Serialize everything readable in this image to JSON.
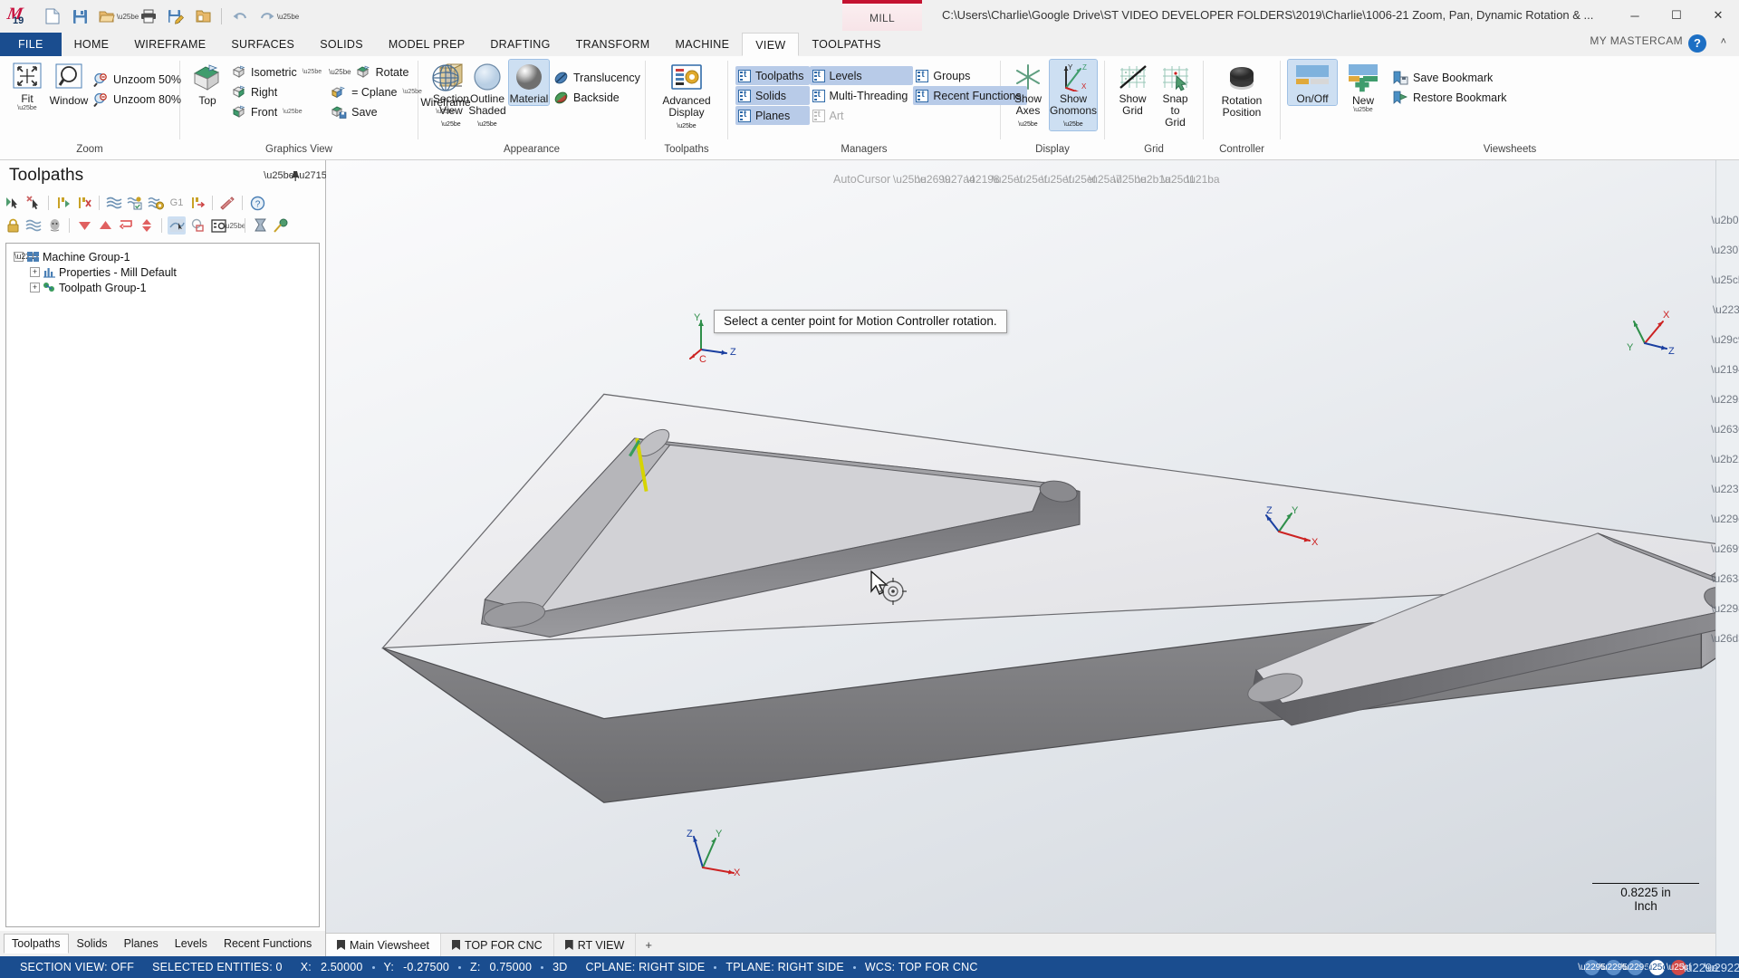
{
  "titlebar": {
    "logo_text": "19",
    "qat": [
      {
        "name": "new-file-icon",
        "glyph": "new"
      },
      {
        "name": "save-icon",
        "glyph": "save"
      },
      {
        "name": "open-folder-icon",
        "glyph": "open"
      },
      {
        "name": "print-icon",
        "glyph": "print"
      },
      {
        "name": "save-as-icon",
        "glyph": "saveas"
      },
      {
        "name": "backup-icon",
        "glyph": "backup"
      },
      {
        "name": "undo-icon",
        "glyph": "undo"
      },
      {
        "name": "redo-icon",
        "glyph": "redo"
      },
      {
        "name": "customize-qat-icon",
        "glyph": "dropdown"
      }
    ],
    "mill_tab": "MILL",
    "file_path": "C:\\Users\\Charlie\\Google Drive\\ST VIDEO DEVELOPER FOLDERS\\2019\\Charlie\\1006-21 Zoom, Pan, Dynamic Rotation & ...",
    "minimize": "─",
    "maximize": "☐",
    "close": "✕"
  },
  "ribbon_tabs": {
    "file": "FILE",
    "tabs": [
      "HOME",
      "WIREFRAME",
      "SURFACES",
      "SOLIDS",
      "MODEL PREP",
      "DRAFTING",
      "TRANSFORM",
      "MACHINE",
      "VIEW",
      "TOOLPATHS"
    ],
    "active": "VIEW",
    "my_mastercam": "MY MASTERCAM",
    "help": "?",
    "collapse": "˄"
  },
  "ribbon": {
    "groups": [
      {
        "name": "zoom",
        "label": "Zoom",
        "big": [
          {
            "label": "Fit",
            "icon": "fit-icon",
            "dropdown": true,
            "selected": false
          },
          {
            "label": "Window",
            "icon": "zoom-window-icon",
            "dropdown": false,
            "selected": false
          }
        ],
        "small": [
          {
            "label": "Unzoom 50%",
            "icon": "unzoom-50-icon"
          },
          {
            "label": "Unzoom 80%",
            "icon": "unzoom-80-icon"
          }
        ]
      },
      {
        "name": "graphics-view",
        "label": "Graphics View",
        "big": [
          {
            "label": "Top",
            "icon": "top-view-icon",
            "dropdown": true,
            "selected": false
          },
          {
            "label": "Section\nView",
            "icon": "section-view-icon",
            "dropdown": true,
            "selected": false
          }
        ],
        "small": [
          {
            "label": "Isometric",
            "icon": "isometric-icon",
            "dropdown": true
          },
          {
            "label": "Right",
            "icon": "right-view-icon"
          },
          {
            "label": "Front",
            "icon": "front-view-icon",
            "dropdown": true
          },
          {
            "label": "Rotate",
            "icon": "rotate-icon"
          },
          {
            "label": "= Cplane",
            "icon": "cplane-icon",
            "dropdown": true
          },
          {
            "label": "Save",
            "icon": "save-view-icon"
          }
        ]
      },
      {
        "name": "appearance",
        "label": "Appearance",
        "big": [
          {
            "label": "Wireframe",
            "icon": "wireframe-icon",
            "dropdown": true,
            "selected": false
          },
          {
            "label": "Outline\nShaded",
            "icon": "outline-shaded-icon",
            "dropdown": true,
            "selected": false
          },
          {
            "label": "Material",
            "icon": "material-icon",
            "dropdown": false,
            "selected": true
          }
        ],
        "small": [
          {
            "label": "Translucency",
            "icon": "translucency-icon"
          },
          {
            "label": "Backside",
            "icon": "backside-icon"
          }
        ],
        "launcher": true
      },
      {
        "name": "toolpaths-display",
        "label": "Toolpaths",
        "big": [
          {
            "label": "Advanced\nDisplay",
            "icon": "advanced-display-icon",
            "dropdown": true,
            "selected": false
          }
        ],
        "small": [],
        "launcher": true
      },
      {
        "name": "managers",
        "label": "Managers",
        "columns": [
          [
            {
              "label": "Toolpaths",
              "icon": "manager-icon",
              "selected": true
            },
            {
              "label": "Solids",
              "icon": "manager-icon",
              "selected": true
            },
            {
              "label": "Planes",
              "icon": "manager-icon",
              "selected": true
            }
          ],
          [
            {
              "label": "Levels",
              "icon": "manager-icon",
              "selected": true
            },
            {
              "label": "Multi-Threading",
              "icon": "manager-icon",
              "selected": false
            },
            {
              "label": "Art",
              "icon": "manager-icon",
              "selected": false,
              "disabled": true
            }
          ],
          [
            {
              "label": "Groups",
              "icon": "manager-icon",
              "selected": false
            },
            {
              "label": "Recent Functions",
              "icon": "manager-icon",
              "selected": true
            }
          ]
        ]
      },
      {
        "name": "display",
        "label": "Display",
        "big": [
          {
            "label": "Show\nAxes",
            "icon": "show-axes-icon",
            "dropdown": true,
            "selected": false
          },
          {
            "label": "Show\nGnomons",
            "icon": "show-gnomons-icon",
            "dropdown": true,
            "selected": true
          }
        ],
        "small": []
      },
      {
        "name": "grid",
        "label": "Grid",
        "big": [
          {
            "label": "Show\nGrid",
            "icon": "show-grid-icon",
            "dropdown": false,
            "selected": false
          },
          {
            "label": "Snap\nto Grid",
            "icon": "snap-to-grid-icon",
            "dropdown": false,
            "selected": false
          }
        ],
        "small": [],
        "launcher": true
      },
      {
        "name": "controller",
        "label": "Controller",
        "big": [
          {
            "label": "Rotation\nPosition",
            "icon": "rotation-position-icon",
            "dropdown": false,
            "selected": false
          }
        ],
        "small": []
      },
      {
        "name": "viewsheets",
        "label": "Viewsheets",
        "big": [
          {
            "label": "On/Off",
            "icon": "viewsheet-onoff-icon",
            "dropdown": false,
            "selected": true
          },
          {
            "label": "New",
            "icon": "viewsheet-new-icon",
            "dropdown": true,
            "selected": false
          }
        ],
        "small": [
          {
            "label": "Save Bookmark",
            "icon": "save-bookmark-icon"
          },
          {
            "label": "Restore Bookmark",
            "icon": "restore-bookmark-icon"
          }
        ],
        "launcher": true
      }
    ]
  },
  "toolpaths_panel": {
    "title": "Toolpaths",
    "header_buttons": [
      {
        "name": "panel-dropdown-button",
        "glyph": "▾"
      },
      {
        "name": "panel-pin-button",
        "glyph": "pin"
      },
      {
        "name": "panel-close-button",
        "glyph": "✕"
      }
    ],
    "toolbar_row1": [
      "select-all-operations-icon",
      "deselect-all-operations-icon",
      "sep",
      "regenerate-selected-icon",
      "delete-selected-icon",
      "sep",
      "regenerate-all-dirty-icon",
      "regenerate-all-selected-icon",
      "regenerate-all-invalid-icon",
      "g1-icon",
      "post-selected-icon",
      "sep",
      "high-speed-toolpath-icon",
      "sep",
      "help-icon"
    ],
    "toolbar_row2": [
      "lock-icon",
      "toggle-posting-icon",
      "toggle-display-icon",
      "sep",
      "move-down-icon",
      "move-up-icon",
      "move-to-folder-icon",
      "sort-icon",
      "sep",
      "toolpath-display-icon",
      "toggle-tool-display-icon",
      "options-icon",
      "dropdown-icon",
      "sep",
      "verify-icon",
      "simulate-icon"
    ],
    "tree": [
      {
        "label": "Machine Group-1",
        "depth": 0,
        "expander": "-",
        "icon": "machine-group-icon"
      },
      {
        "label": "Properties - Mill Default",
        "depth": 1,
        "expander": "+",
        "icon": "properties-icon"
      },
      {
        "label": "Toolpath Group-1",
        "depth": 1,
        "expander": "+",
        "icon": "toolpath-group-icon"
      }
    ],
    "tabs": [
      {
        "label": "Toolpaths",
        "active": true
      },
      {
        "label": "Solids",
        "active": false
      },
      {
        "label": "Planes",
        "active": false
      },
      {
        "label": "Levels",
        "active": false
      },
      {
        "label": "Recent Functions",
        "active": false
      }
    ]
  },
  "graphics": {
    "tooltip": "Select a center point for Motion Controller rotation.",
    "autocursor_label": "AutoCursor",
    "gnomon_wcs": {
      "x": "X",
      "y": "Y",
      "z": "Z",
      "origin": "C"
    },
    "gnomon_center": {
      "x": "X",
      "y": "Y",
      "z": "Z"
    },
    "gnomon_bottom": {
      "x": "X",
      "y": "Y",
      "z": "Z"
    },
    "gnomon_topright": {
      "x": "X",
      "y": "Y",
      "z": "Z"
    },
    "scale_value": "0.8225 in",
    "scale_units": "Inch"
  },
  "viewsheet_tabs": {
    "tabs": [
      {
        "label": "Main Viewsheet",
        "active": true,
        "bookmark": true
      },
      {
        "label": "TOP FOR CNC",
        "active": false,
        "bookmark": true
      },
      {
        "label": "RT VIEW",
        "active": false,
        "bookmark": true
      }
    ],
    "add": "+"
  },
  "statusbar": {
    "section_view": "SECTION VIEW: OFF",
    "selected_entities": "SELECTED ENTITIES: 0",
    "x_label": "X:",
    "x_value": "2.50000",
    "y_label": "Y:",
    "y_value": "-0.27500",
    "z_label": "Z:",
    "z_value": "0.75000",
    "mode": "3D",
    "cplane": "CPLANE: RIGHT SIDE",
    "tplane": "TPLANE: RIGHT SIDE",
    "wcs": "WCS: TOP FOR CNC",
    "right_icons": [
      "globe-icon",
      "cplane-globe-icon",
      "tplane-globe-icon",
      "wcs-blue-icon",
      "red-dot-icon",
      "grid-icon",
      "expand-icon"
    ]
  },
  "colors": {
    "accent_blue": "#1a4d8f",
    "ribbon_selected": "#cddff2",
    "mill_red": "#c41230",
    "axis_x": "#cc2222",
    "axis_y": "#1f8f3c",
    "axis_z": "#1a3fa0"
  }
}
